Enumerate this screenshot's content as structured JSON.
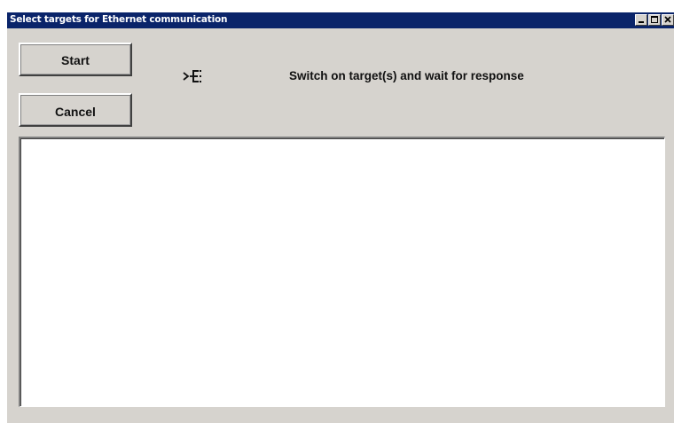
{
  "window": {
    "title": "Select targets for Ethernet communication",
    "title_bar_color": "#0a246a",
    "background_color": "#d6d3ce",
    "controls": {
      "minimize_icon": "minimize-icon",
      "maximize_icon": "maximize-icon",
      "close_icon": "close-icon"
    }
  },
  "actions": {
    "start_label": "Start",
    "cancel_label": "Cancel"
  },
  "status": {
    "icon": "ethernet-target-icon",
    "message": "Switch on target(s) and wait for response"
  },
  "targets_list": {
    "items": []
  }
}
